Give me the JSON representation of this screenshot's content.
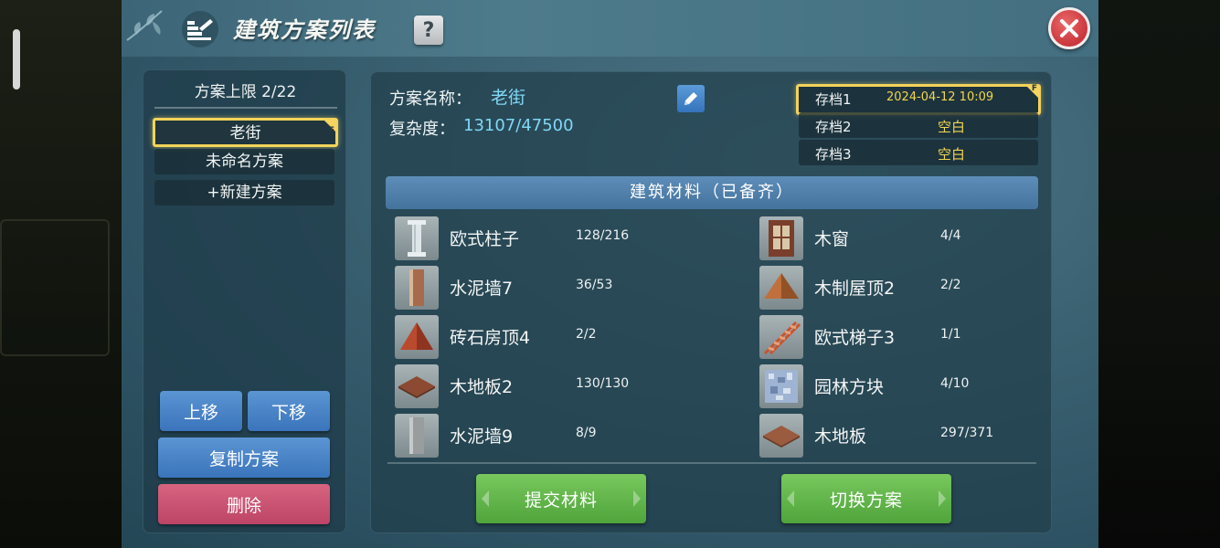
{
  "window": {
    "title": "建筑方案列表",
    "help_label": "?"
  },
  "left_panel": {
    "quota": "方案上限 2/22",
    "plans": [
      {
        "name": "老街",
        "active": true,
        "flag": "F"
      },
      {
        "name": "未命名方案",
        "active": false
      },
      {
        "name": "+新建方案",
        "active": false
      }
    ],
    "buttons": {
      "move_up": "上移",
      "move_down": "下移",
      "copy": "复制方案",
      "delete": "删除"
    }
  },
  "plan_detail": {
    "name_label": "方案名称：",
    "name_value": "老街",
    "complexity_label": "复杂度：",
    "complexity_value": "13107/47500",
    "saves": [
      {
        "label": "存档1",
        "value": "2024-04-12 10:09",
        "active": true,
        "flag": "F"
      },
      {
        "label": "存档2",
        "value": "空白",
        "active": false
      },
      {
        "label": "存档3",
        "value": "空白",
        "active": false
      }
    ],
    "materials_header": "建筑材料（已备齐）",
    "materials_left": [
      {
        "name": "欧式柱子",
        "count": "128/216",
        "icon": "pillar-icon"
      },
      {
        "name": "水泥墙7",
        "count": "36/53",
        "icon": "wall-icon"
      },
      {
        "name": "砖石房顶4",
        "count": "2/2",
        "icon": "roof-icon"
      },
      {
        "name": "木地板2",
        "count": "130/130",
        "icon": "floor-icon"
      },
      {
        "name": "水泥墙9",
        "count": "8/9",
        "icon": "wall-icon"
      }
    ],
    "materials_right": [
      {
        "name": "木窗",
        "count": "4/4",
        "icon": "window-icon"
      },
      {
        "name": "木制屋顶2",
        "count": "2/2",
        "icon": "roof-icon"
      },
      {
        "name": "欧式梯子3",
        "count": "1/1",
        "icon": "stairs-icon"
      },
      {
        "name": "园林方块",
        "count": "4/10",
        "icon": "block-icon"
      },
      {
        "name": "木地板",
        "count": "297/371",
        "icon": "floor-icon"
      }
    ],
    "submit_label": "提交材料",
    "switch_label": "切换方案"
  },
  "colors": {
    "accent_gold": "#f2d35a",
    "value_cyan": "#7fd8f6",
    "save_value": "#f3d64e",
    "green_button": "#5fb548",
    "blue_button": "#4a84c7",
    "red_button": "#cc5272"
  }
}
